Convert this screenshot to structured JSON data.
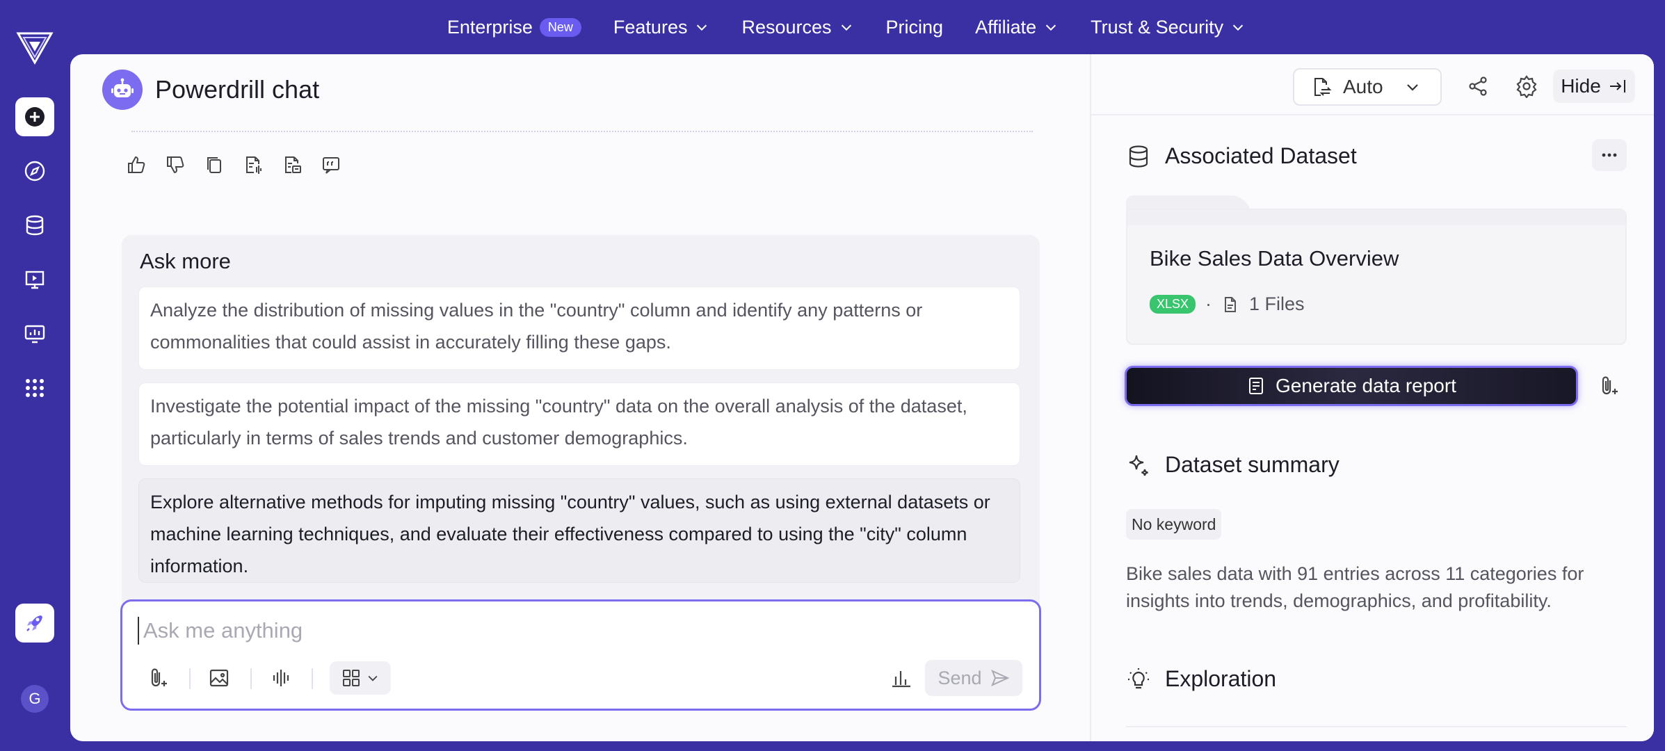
{
  "nav": {
    "items": [
      {
        "label": "Enterprise",
        "badge": "New",
        "has_chevron": false
      },
      {
        "label": "Features",
        "has_chevron": true
      },
      {
        "label": "Resources",
        "has_chevron": true
      },
      {
        "label": "Pricing",
        "has_chevron": false
      },
      {
        "label": "Affiliate",
        "has_chevron": true
      },
      {
        "label": "Trust & Security",
        "has_chevron": true
      }
    ]
  },
  "sidebar": {
    "items": [
      "new-chat-icon",
      "explore-compass-icon",
      "dataset-database-icon",
      "presentation-icon",
      "monitor-report-icon",
      "apps-grid-icon"
    ],
    "launch_icon": "rocket-icon",
    "avatar_initial": "G"
  },
  "chat": {
    "title": "Powerdrill chat",
    "feedback_icons": [
      "thumbs-up-icon",
      "thumbs-down-icon",
      "copy-icon",
      "audio-doc-icon",
      "report-doc-icon",
      "quote-icon"
    ],
    "ask_more_title": "Ask more",
    "suggestions": [
      "Analyze the distribution of missing values in the \"country\" column and identify any patterns or commonalities that could assist in accurately filling these gaps.",
      "Investigate the potential impact of the missing \"country\" data on the overall analysis of the dataset, particularly in terms of sales trends and customer demographics.",
      "Explore alternative methods for imputing missing \"country\" values, such as using external datasets or machine learning techniques, and evaluate their effectiveness compared to using the \"city\" column information."
    ],
    "input": {
      "placeholder": "Ask me anything",
      "value": "",
      "send_label": "Send"
    }
  },
  "panel": {
    "mode_select": "Auto",
    "hide_label": "Hide",
    "associated_dataset_title": "Associated Dataset",
    "dataset": {
      "name": "Bike Sales Data Overview",
      "format_badge": "XLSX",
      "separator": "·",
      "files": "1 Files"
    },
    "generate_label": "Generate data report",
    "summary_title": "Dataset summary",
    "keyword_chip": "No keyword",
    "summary_text": "Bike sales data with 91 entries across 11 categories for insights into trends, demographics, and profitability.",
    "exploration_title": "Exploration"
  },
  "colors": {
    "brand": "#3a2fa3",
    "accent": "#7b6cf0",
    "badge_green": "#39c46e"
  }
}
